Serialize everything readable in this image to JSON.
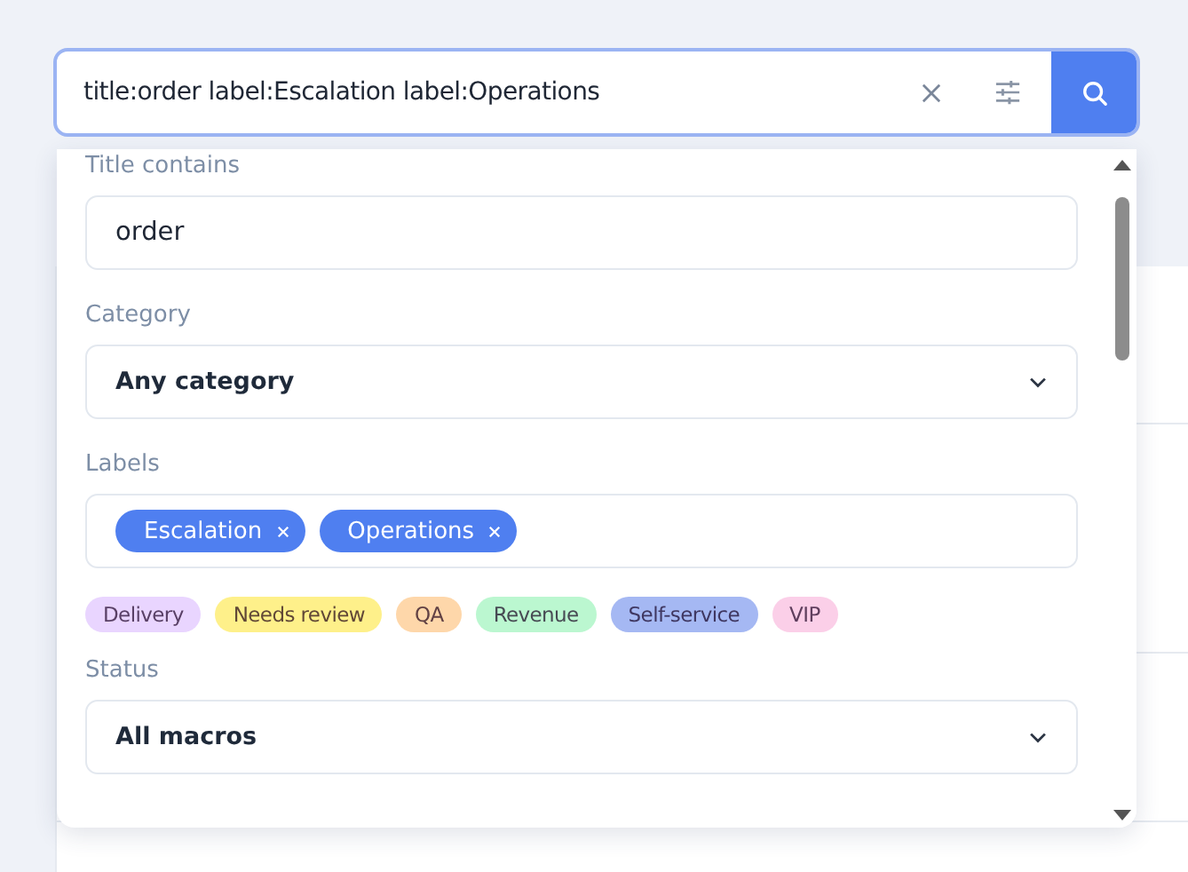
{
  "search": {
    "value": "title:order label:Escalation label:Operations"
  },
  "filters": {
    "title_label": "Title contains",
    "title_value": "order",
    "category_label": "Category",
    "category_value": "Any category",
    "labels_label": "Labels",
    "selected_labels": [
      "Escalation",
      "Operations"
    ],
    "suggestions": [
      {
        "label": "Delivery",
        "color": "#e9d5ff"
      },
      {
        "label": "Needs review",
        "color": "#fef08a"
      },
      {
        "label": "QA",
        "color": "#fed7aa"
      },
      {
        "label": "Revenue",
        "color": "#bbf7d0"
      },
      {
        "label": "Self-service",
        "color": "#a5b8f3"
      },
      {
        "label": "VIP",
        "color": "#fbcfe8"
      }
    ],
    "status_label": "Status",
    "status_value": "All macros"
  }
}
